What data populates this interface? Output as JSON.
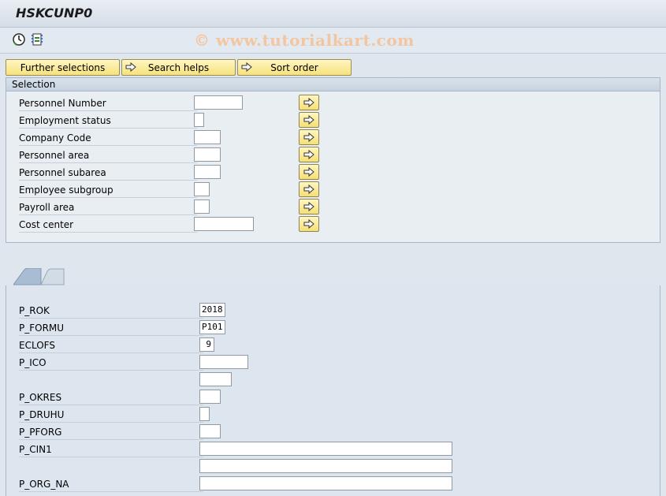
{
  "window": {
    "title": "HSKCUNP0"
  },
  "toolbar": {
    "watermark": "© www.tutorialkart.com",
    "icons": [
      "execute-icon",
      "selection-screen-icon"
    ]
  },
  "buttons": {
    "further_selections": "Further selections",
    "search_helps": "Search helps",
    "sort_order": "Sort order"
  },
  "selection": {
    "title": "Selection",
    "rows": [
      {
        "label": "Personnel Number",
        "value": ""
      },
      {
        "label": "Employment status",
        "value": ""
      },
      {
        "label": "Company Code",
        "value": ""
      },
      {
        "label": "Personnel area",
        "value": ""
      },
      {
        "label": "Personnel subarea",
        "value": ""
      },
      {
        "label": "Employee subgroup",
        "value": ""
      },
      {
        "label": "Payroll area",
        "value": ""
      },
      {
        "label": "Cost center",
        "value": ""
      }
    ]
  },
  "params": {
    "rows": [
      {
        "label": "P_ROK",
        "value": "2018"
      },
      {
        "label": "P_FORMU",
        "value": "P101"
      },
      {
        "label": "ECLOFS",
        "value": "9"
      },
      {
        "label": "P_ICO",
        "value": ""
      },
      {
        "label": "",
        "value": ""
      },
      {
        "label": "P_OKRES",
        "value": ""
      },
      {
        "label": "P_DRUHU",
        "value": ""
      },
      {
        "label": "P_PFORG",
        "value": ""
      },
      {
        "label": "P_CIN1",
        "value": ""
      },
      {
        "label": "",
        "value": ""
      },
      {
        "label": "P_ORG_NA",
        "value": ""
      }
    ]
  },
  "colors": {
    "background": "#dfe6ee",
    "button_yellow": "#f7e27c",
    "tab_blue": "#a8bcd3"
  }
}
